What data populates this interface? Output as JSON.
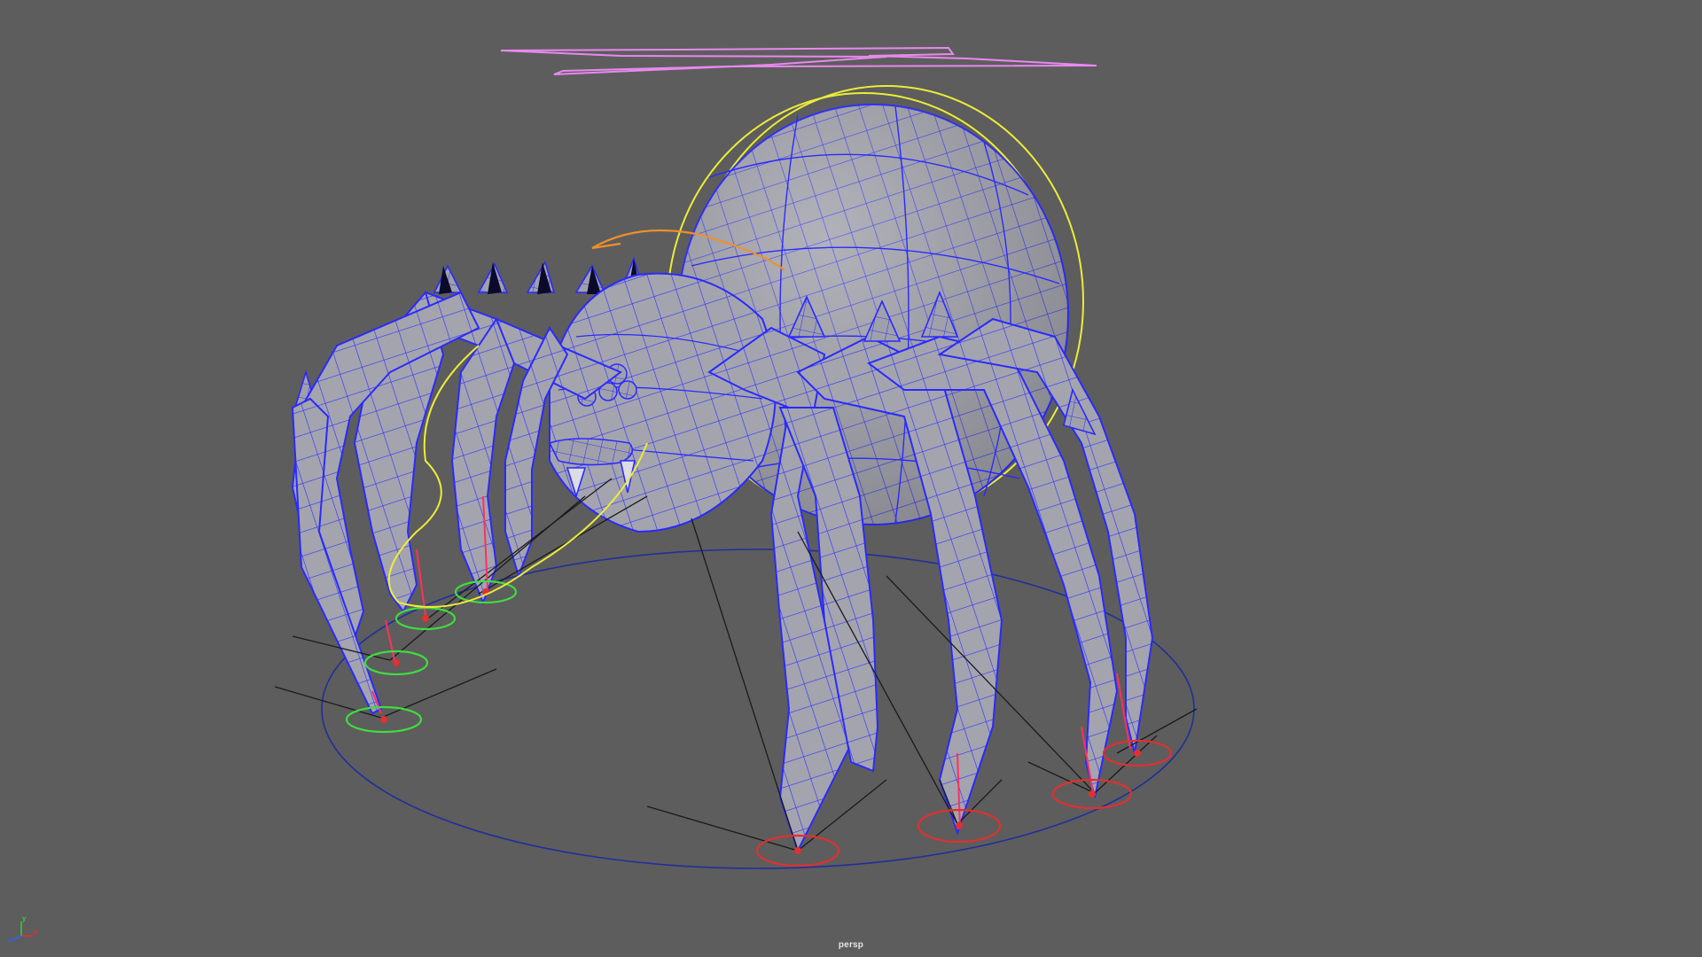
{
  "viewport": {
    "camera_name": "persp",
    "background_color": "#5d5d5d",
    "wireframe_color": "#2a2aff",
    "mesh_color": "#a3a3ad"
  },
  "axis_gizmo": {
    "x_label": "x",
    "y_label": "y",
    "z_label": "z",
    "x_color": "#e03030",
    "y_color": "#30d030",
    "z_color": "#3060ff"
  },
  "controls": {
    "main_control_color": "#e889ef",
    "body_control_color": "#ecec3a",
    "head_control_color": "#f0902a",
    "ik_left_color": "#3fdd3f",
    "ik_right_color": "#e03030"
  }
}
